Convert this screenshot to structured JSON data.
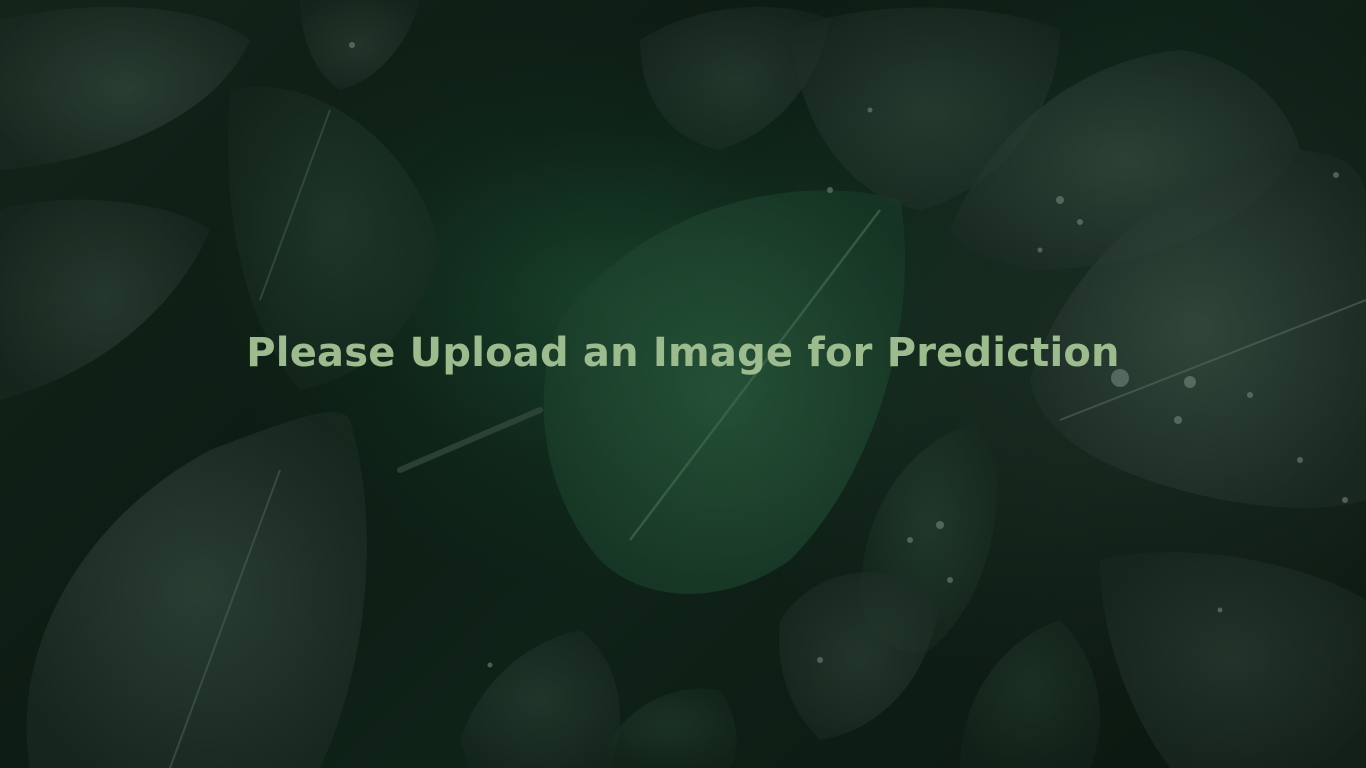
{
  "main": {
    "prompt_text": "Please Upload an Image for Prediction"
  },
  "background": {
    "description_icon": "dark-leaves-background",
    "accent_color": "#9cbb8e"
  }
}
